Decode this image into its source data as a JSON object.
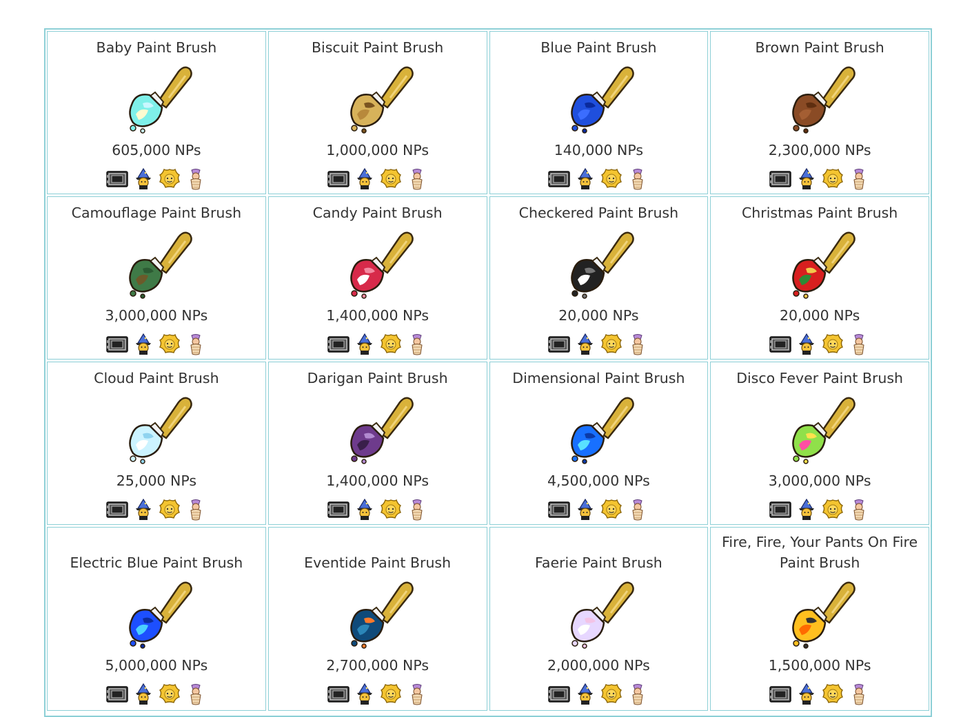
{
  "items": [
    {
      "name": "Baby Paint Brush",
      "price": "605,000 NPs",
      "colors": [
        "#7ff0e9",
        "#fffbd0",
        "#c9f7ff"
      ],
      "icons": [
        "sdb-icon",
        "closet-icon",
        "neggfest-icon",
        "gallery-icon"
      ]
    },
    {
      "name": "Biscuit Paint Brush",
      "price": "1,000,000 NPs",
      "colors": [
        "#d7b25a",
        "#b8893b",
        "#7a5420"
      ],
      "icons": [
        "sdb-icon",
        "closet-icon",
        "neggfest-icon",
        "gallery-icon"
      ]
    },
    {
      "name": "Blue Paint Brush",
      "price": "140,000 NPs",
      "colors": [
        "#1f4fdd",
        "#3b6dff",
        "#0a2a9c"
      ],
      "icons": [
        "sdb-icon",
        "closet-icon",
        "neggfest-icon",
        "gallery-icon"
      ]
    },
    {
      "name": "Brown Paint Brush",
      "price": "2,300,000 NPs",
      "colors": [
        "#8a4b25",
        "#a45e33",
        "#5e2e10"
      ],
      "icons": [
        "sdb-icon",
        "closet-icon",
        "neggfest-icon",
        "gallery-icon"
      ]
    },
    {
      "name": "Camouflage Paint Brush",
      "price": "3,000,000 NPs",
      "colors": [
        "#3f7a47",
        "#6c5a2a",
        "#2c5b33"
      ],
      "icons": [
        "sdb-icon",
        "closet-icon",
        "neggfest-icon",
        "gallery-icon"
      ]
    },
    {
      "name": "Candy Paint Brush",
      "price": "1,400,000 NPs",
      "colors": [
        "#d72a4a",
        "#ffffff",
        "#f38aa1"
      ],
      "icons": [
        "sdb-icon",
        "closet-icon",
        "neggfest-icon",
        "gallery-icon"
      ]
    },
    {
      "name": "Checkered Paint Brush",
      "price": "20,000 NPs",
      "colors": [
        "#222222",
        "#ffffff",
        "#777777"
      ],
      "icons": [
        "sdb-icon",
        "closet-icon",
        "neggfest-icon",
        "gallery-icon"
      ]
    },
    {
      "name": "Christmas Paint Brush",
      "price": "20,000 NPs",
      "colors": [
        "#d81f1f",
        "#2e8a35",
        "#f2c94c"
      ],
      "icons": [
        "sdb-icon",
        "closet-icon",
        "neggfest-icon",
        "gallery-icon"
      ]
    },
    {
      "name": "Cloud Paint Brush",
      "price": "25,000 NPs",
      "colors": [
        "#ccf3ff",
        "#ffffff",
        "#8fd3ef"
      ],
      "icons": [
        "sdb-icon",
        "closet-icon",
        "neggfest-icon",
        "gallery-icon"
      ]
    },
    {
      "name": "Darigan Paint Brush",
      "price": "1,400,000 NPs",
      "colors": [
        "#6e3b8c",
        "#3a1f4a",
        "#b18ad0"
      ],
      "icons": [
        "sdb-icon",
        "closet-icon",
        "neggfest-icon",
        "gallery-icon"
      ]
    },
    {
      "name": "Dimensional Paint Brush",
      "price": "4,500,000 NPs",
      "colors": [
        "#1870ff",
        "#59e1ff",
        "#0b3aa8"
      ],
      "icons": [
        "sdb-icon",
        "closet-icon",
        "neggfest-icon",
        "gallery-icon"
      ]
    },
    {
      "name": "Disco Fever Paint Brush",
      "price": "3,000,000 NPs",
      "colors": [
        "#90e04a",
        "#ff4fa3",
        "#ffe14d"
      ],
      "icons": [
        "sdb-icon",
        "closet-icon",
        "neggfest-icon",
        "gallery-icon"
      ]
    },
    {
      "name": "Electric Blue Paint Brush",
      "price": "5,000,000 NPs",
      "colors": [
        "#1d4fff",
        "#4ad0ff",
        "#0c2c9e"
      ],
      "icons": [
        "sdb-icon",
        "closet-icon",
        "neggfest-icon",
        "gallery-icon"
      ]
    },
    {
      "name": "Eventide Paint Brush",
      "price": "2,700,000 NPs",
      "colors": [
        "#0f4a7a",
        "#2b86b8",
        "#ff7a2a"
      ],
      "icons": [
        "sdb-icon",
        "closet-icon",
        "neggfest-icon",
        "gallery-icon"
      ]
    },
    {
      "name": "Faerie Paint Brush",
      "price": "2,000,000 NPs",
      "colors": [
        "#e7d7ff",
        "#ffffff",
        "#f3c3e6"
      ],
      "icons": [
        "sdb-icon",
        "closet-icon",
        "neggfest-icon",
        "gallery-icon"
      ]
    },
    {
      "name": "Fire, Fire, Your Pants On Fire Paint Brush",
      "price": "1,500,000 NPs",
      "colors": [
        "#ffbf1f",
        "#ff6a00",
        "#333333"
      ],
      "icons": [
        "sdb-icon",
        "closet-icon",
        "neggfest-icon",
        "gallery-icon"
      ]
    }
  ],
  "theme": {
    "border": "#8ccfd6",
    "handle": "#d9b23a"
  }
}
